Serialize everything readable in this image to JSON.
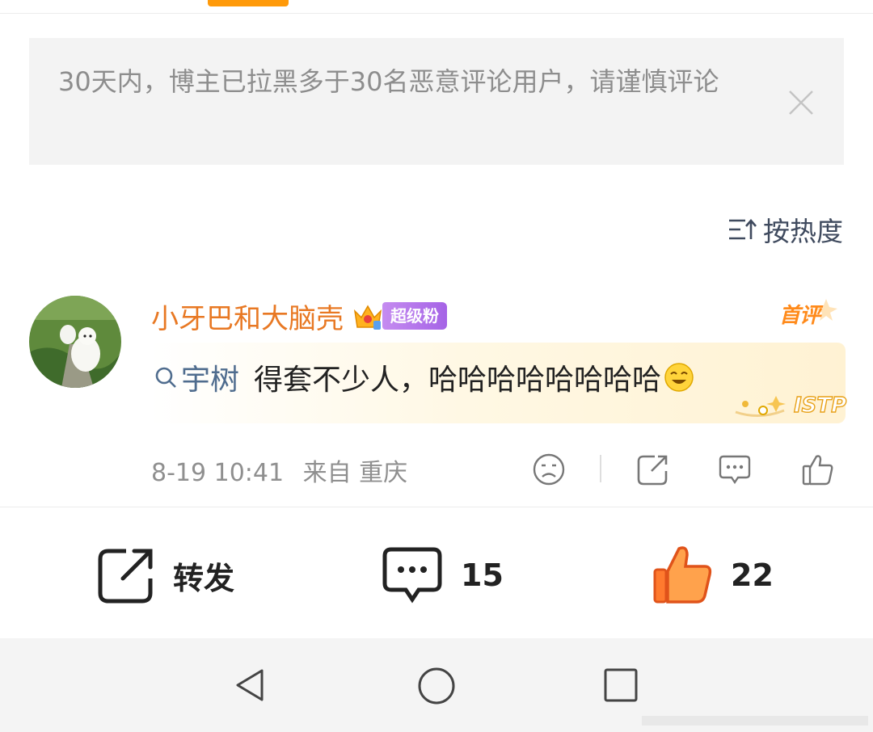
{
  "notice": {
    "text": "30天内，博主已拉黑多于30名恶意评论用户，请谨慎评论"
  },
  "sort": {
    "label": "按热度"
  },
  "comment": {
    "author": "小牙巴和大脑壳",
    "fan_badge": "超级粉",
    "first_comment_tag": "首评",
    "mention": "宇树",
    "text": "得套不少人，哈哈哈哈哈哈哈哈",
    "date": "8-19 10:41",
    "source": "来自 重庆",
    "istp_label": "ISTP"
  },
  "bottom_bar": {
    "repost_label": "转发",
    "comment_count": "15",
    "like_count": "22"
  },
  "colors": {
    "accent": "#ff9a0a",
    "author": "#e87823",
    "mention": "#4f6c8e",
    "like": "#ff7a2e"
  }
}
